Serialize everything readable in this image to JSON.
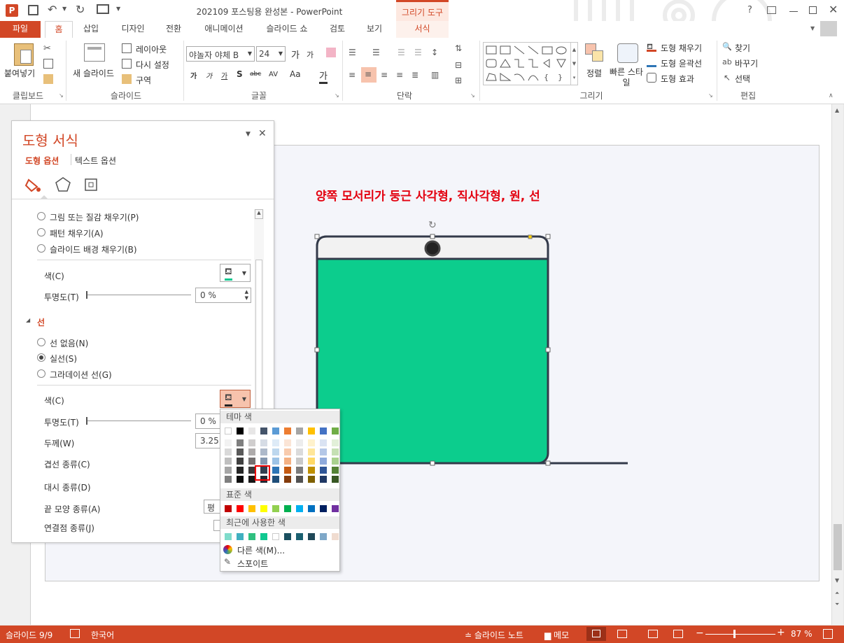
{
  "app": {
    "title": "202109 포스팅용 완성본 - PowerPoint",
    "contextual_tab_group": "그리기 도구"
  },
  "window_controls": {
    "help": "?"
  },
  "tabs": [
    {
      "label": "파일"
    },
    {
      "label": "홈"
    },
    {
      "label": "삽입"
    },
    {
      "label": "디자인"
    },
    {
      "label": "전환"
    },
    {
      "label": "애니메이션"
    },
    {
      "label": "슬라이드 쇼"
    },
    {
      "label": "검토"
    },
    {
      "label": "보기"
    },
    {
      "label": "서식"
    }
  ],
  "ribbon": {
    "clipboard": {
      "paste": "붙여넣기",
      "group": "클립보드"
    },
    "slides": {
      "new_slide": "새 슬라이드",
      "layout": "레이아웃",
      "reset": "다시 설정",
      "section": "구역",
      "group": "슬라이드"
    },
    "font": {
      "font_name": "야놀자 야체 B",
      "font_size": "24",
      "group": "글꼴",
      "grow": "가",
      "shrink": "가",
      "bold": "가",
      "italic": "가",
      "underline": "가",
      "shadow": "S",
      "strike": "abc",
      "spacing": "AV",
      "case": "Aa",
      "color": "가"
    },
    "paragraph": {
      "group": "단락"
    },
    "drawing": {
      "arrange": "정렬",
      "quick_styles": "빠른 스타일",
      "shape_fill": "도형 채우기",
      "shape_outline": "도형 윤곽선",
      "shape_effects": "도형 효과",
      "group": "그리기"
    },
    "editing": {
      "find": "찾기",
      "replace": "바꾸기",
      "select": "선택",
      "group": "편집"
    }
  },
  "format_pane": {
    "title": "도형 서식",
    "tabs": [
      "도형 옵션",
      "텍스트 옵션"
    ],
    "fill_options": [
      "그림 또는 질감 채우기(P)",
      "패턴 채우기(A)",
      "슬라이드 배경 채우기(B)"
    ],
    "fill_color_label": "색(C)",
    "fill_transparency_label": "투명도(T)",
    "fill_transparency_value": "0 %",
    "line_section": "선",
    "line_options": [
      "선 없음(N)",
      "실선(S)",
      "그라데이션 선(G)"
    ],
    "line_selected_index": 1,
    "line_color_label": "색(C)",
    "line_transparency_label": "투명도(T)",
    "line_transparency_value": "0 %",
    "width_label": "두께(W)",
    "width_value": "3.25",
    "compound_label": "겹선 종류(C)",
    "dash_label": "대시 종류(D)",
    "cap_label": "끝 모양 종류(A)",
    "cap_value": "평",
    "join_label": "연결점 종류(J)"
  },
  "slide": {
    "title": "양쪽 모서리가 둥근 사각형, 직사각형, 원, 선",
    "title_color": "#e3000f",
    "shape_fill": "#0ccd8d",
    "shape_outline": "#333a4a",
    "header_fill": "#f2f2f2"
  },
  "palette": {
    "theme_header": "테마 색",
    "standard_header": "표준 색",
    "recent_header": "최근에 사용한 색",
    "more_colors": "다른 색(M)...",
    "eyedropper": "스포이트",
    "theme_top": [
      "#ffffff",
      "#000000",
      "#e7e6e6",
      "#44546a",
      "#5b9bd5",
      "#ed7d31",
      "#a5a5a5",
      "#ffc000",
      "#4472c4",
      "#70ad47"
    ],
    "theme_shades": [
      [
        "#f2f2f2",
        "#7f7f7f",
        "#d0cece",
        "#d6dce5",
        "#deebf7",
        "#fbe5d6",
        "#ededed",
        "#fff2cc",
        "#dae3f3",
        "#e2f0d9"
      ],
      [
        "#d9d9d9",
        "#595959",
        "#aeabab",
        "#adb9ca",
        "#bdd7ee",
        "#f8cbad",
        "#dbdbdb",
        "#ffe699",
        "#b4c7e7",
        "#c5e0b4"
      ],
      [
        "#bfbfbf",
        "#404040",
        "#757171",
        "#8497b0",
        "#9dc3e6",
        "#f4b183",
        "#c9c9c9",
        "#ffd966",
        "#8faadc",
        "#a9d18e"
      ],
      [
        "#a6a6a6",
        "#262626",
        "#3b3838",
        "#333f50",
        "#2e75b6",
        "#c55a11",
        "#7b7b7b",
        "#bf9000",
        "#2f5597",
        "#548235"
      ],
      [
        "#7f7f7f",
        "#0d0d0d",
        "#171616",
        "#222a35",
        "#1f4e79",
        "#843c0c",
        "#525252",
        "#7f6000",
        "#203864",
        "#385723"
      ]
    ],
    "standard": [
      "#c00000",
      "#ff0000",
      "#ffc000",
      "#ffff00",
      "#92d050",
      "#00b050",
      "#00b0f0",
      "#0070c0",
      "#002060",
      "#7030a0"
    ],
    "recent": [
      "#7fdccb",
      "#40b0c0",
      "#30c080",
      "#10c890",
      "#ffffff",
      "#1a5060",
      "#1a6070",
      "#204858",
      "#7fa8c8",
      "#f0dcd0"
    ]
  },
  "status": {
    "slide_info": "슬라이드 9/9",
    "language": "한국어",
    "notes": "슬라이드 노트",
    "comments": "메모",
    "zoom": "87 %"
  }
}
